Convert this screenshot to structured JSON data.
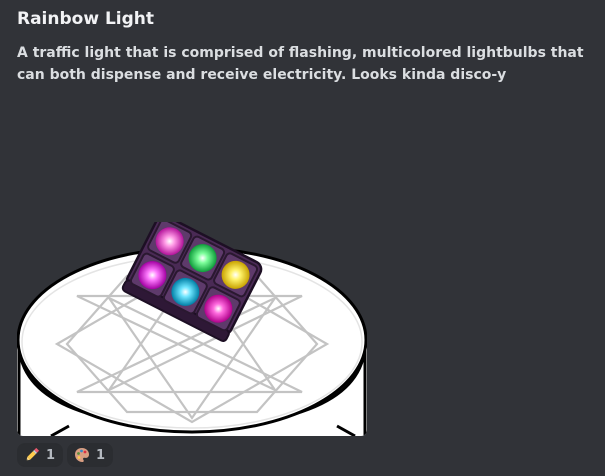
{
  "message": {
    "title": "Rainbow Light",
    "description": "A traffic light that is comprised of flashing, multicolored lightbulbs that can both dispense and receive electricity. Looks kinda disco-y"
  },
  "image": {
    "subject_icon": "rainbow-light-block",
    "bulb_colors": [
      "#ff6ad5",
      "#33ff66",
      "#ffe000",
      "#ff33ff",
      "#22ccff",
      "#ff2ecf"
    ],
    "pedestal_icon": "pentagram-pedestal"
  },
  "reactions": [
    {
      "emoji_icon": "pencil-icon",
      "count": "1"
    },
    {
      "emoji_icon": "palette-icon",
      "count": "1"
    }
  ]
}
